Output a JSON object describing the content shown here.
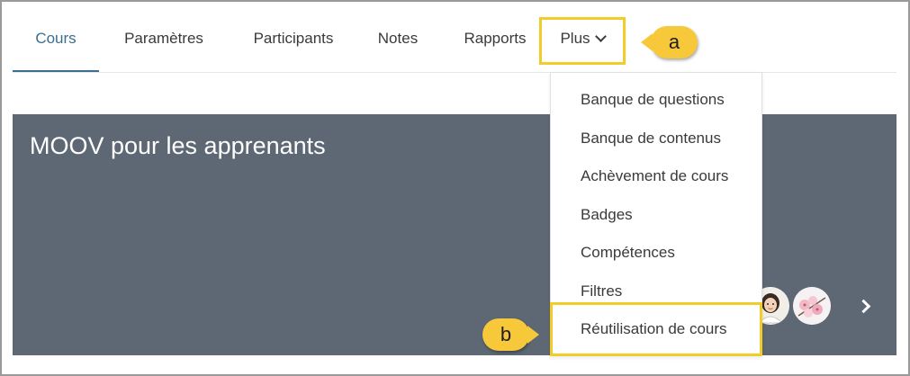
{
  "nav": {
    "tabs": [
      {
        "label": "Cours",
        "active": true
      },
      {
        "label": "Paramètres"
      },
      {
        "label": "Participants"
      },
      {
        "label": "Notes"
      },
      {
        "label": "Rapports"
      },
      {
        "label": "Plus"
      }
    ]
  },
  "dropdown": {
    "items": [
      {
        "label": "Banque de questions"
      },
      {
        "label": "Banque de contenus"
      },
      {
        "label": "Achèvement de cours"
      },
      {
        "label": "Badges"
      },
      {
        "label": "Compétences"
      },
      {
        "label": "Filtres"
      },
      {
        "label": "Réutilisation de cours"
      }
    ]
  },
  "banner": {
    "title": "MOOV pour les apprenants",
    "background_color": "#5d6874"
  },
  "callouts": {
    "a": "a",
    "b": "b",
    "color": "#f7c93a"
  },
  "colors": {
    "accent": "#3b6e8f",
    "highlight": "#f2cd2a"
  },
  "icons": {
    "plus_chevron": "chevron-down-icon",
    "banner_next": "chevron-right-icon"
  }
}
